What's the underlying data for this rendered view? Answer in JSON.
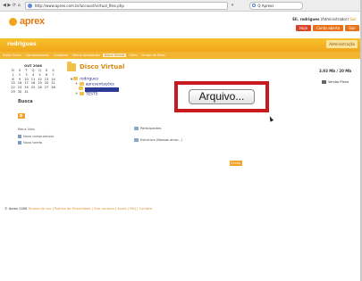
{
  "browser": {
    "nav": "◀ ▶ ⟳ ⌂",
    "url": "http://www.aprex.com.br/account/virtual_files.php",
    "search": "Q Aprexs"
  },
  "header": {
    "logo_text": "aprex",
    "user_name": "Eli. rodrigues",
    "user_role": "(Administrador)",
    "user_extra": "Sair",
    "buttons": [
      "Hoje",
      "Conta aberta",
      "Sair"
    ]
  },
  "band": {
    "title": "rodrigues",
    "admin_label": "Administração"
  },
  "menu": {
    "items": [
      "Visão Geral",
      "Compromissos",
      "Contatos",
      "Minha Atividades",
      "Disco Virtual",
      "Sites",
      "Grupo de Sites"
    ],
    "active_index": 4
  },
  "calendar": {
    "title": "OUT 2006",
    "rows": [
      [
        "D",
        "S",
        "T",
        "Q",
        "Q",
        "S",
        "S"
      ],
      [
        "1",
        "2",
        "3",
        "4",
        "5",
        "6",
        "7"
      ],
      [
        "8",
        "9",
        "10",
        "11",
        "12",
        "13",
        "14"
      ],
      [
        "15",
        "16",
        "17",
        "18",
        "19",
        "20",
        "21"
      ],
      [
        "22",
        "23",
        "24",
        "25",
        "26",
        "27",
        "28"
      ],
      [
        "29",
        "30",
        "31",
        "",
        "",
        "",
        ""
      ]
    ]
  },
  "sidebar": {
    "busca_label": "Busca",
    "group_label": "Meus links",
    "links": [
      "Novo compromisso",
      "Nova tarefa"
    ]
  },
  "disco": {
    "title": "Disco Virtual",
    "tree": [
      {
        "label": "rodrigues",
        "prefix": "▾"
      },
      {
        "label": "apresentações",
        "prefix": "+"
      },
      {
        "label": "selecionado",
        "prefix": "",
        "selected": true
      },
      {
        "label": "TESTS",
        "prefix": "+"
      }
    ],
    "storage": "3.93 Mb / 20 Mb",
    "print_label": "Versão Plena"
  },
  "upload": {
    "button_label": "Arquivo..."
  },
  "files": [
    {
      "label": "Participantes"
    },
    {
      "label": "Estrutura (Nossas amor...)"
    }
  ],
  "ok_label": "Enviar",
  "footer": {
    "copyright": "© Aprex 2006",
    "links": "Termos de uso | Política de Privacidade | Fale conosco | Ajuda | FAQ | Contato"
  }
}
